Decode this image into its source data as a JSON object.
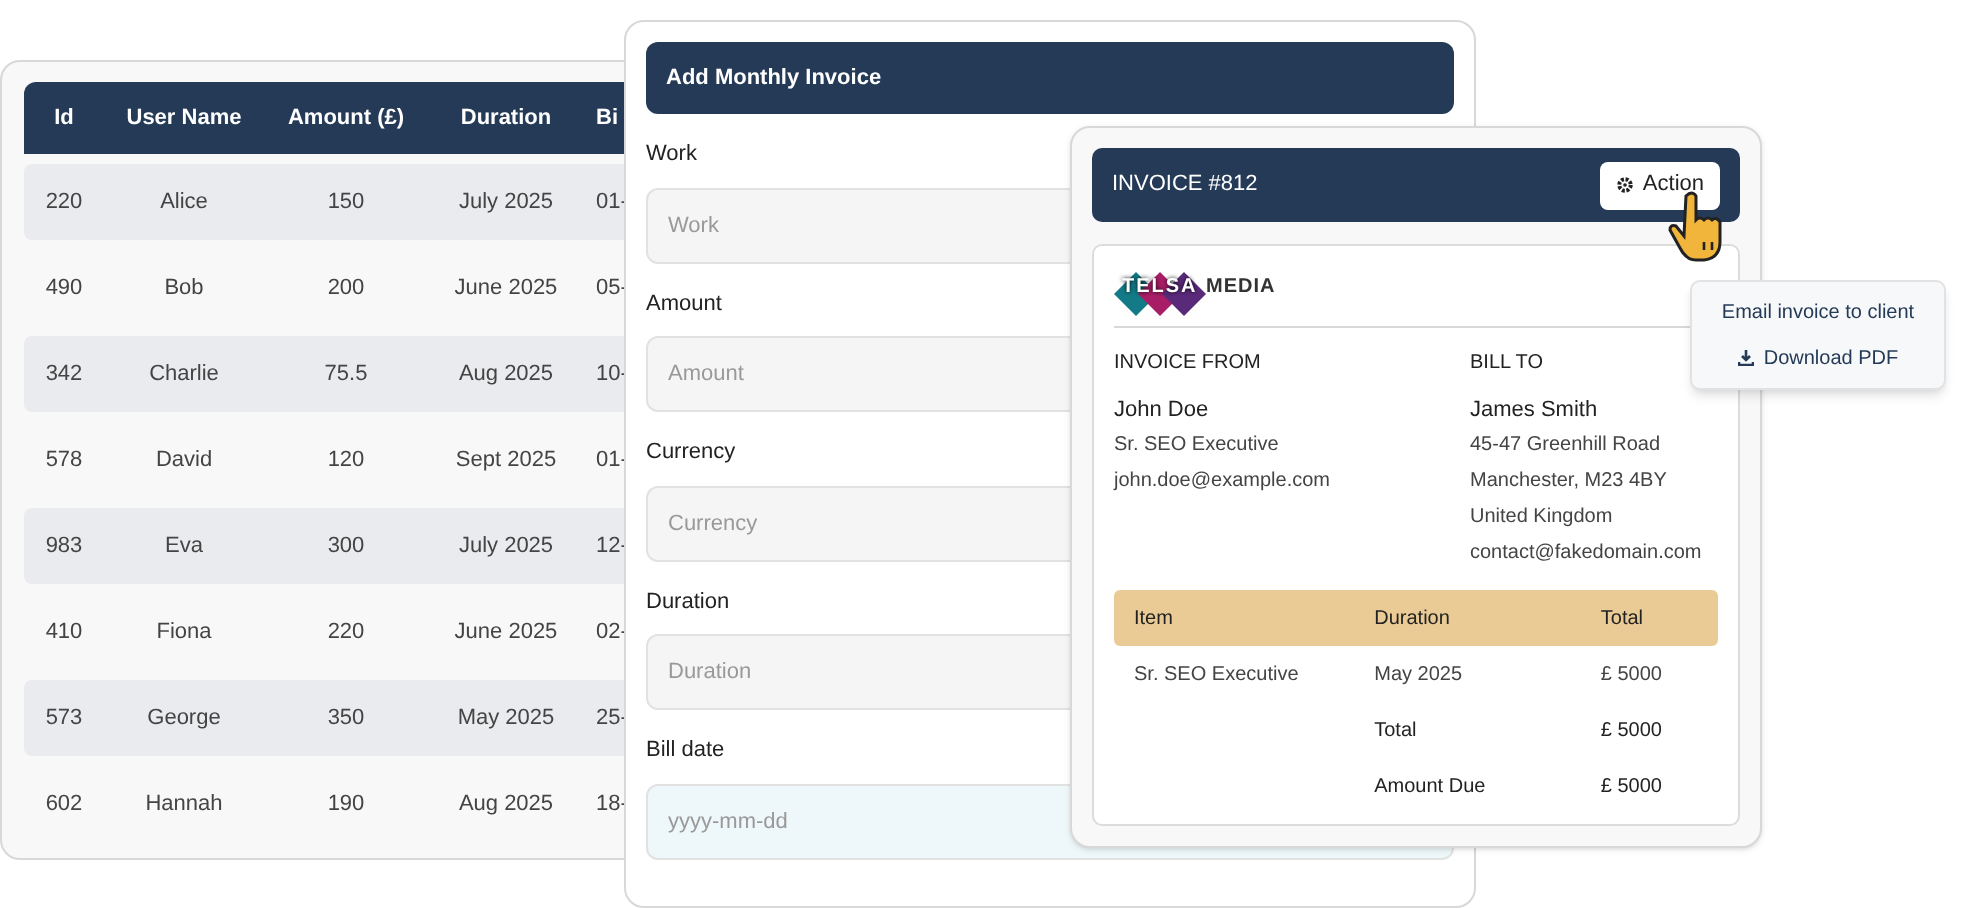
{
  "table": {
    "columns": [
      "Id",
      "User Name",
      "Amount (£)",
      "Duration",
      "Bi"
    ],
    "rows": [
      [
        "220",
        "Alice",
        "150",
        "July 2025",
        "01-"
      ],
      [
        "490",
        "Bob",
        "200",
        "June 2025",
        "05-"
      ],
      [
        "342",
        "Charlie",
        "75.5",
        "Aug 2025",
        "10-"
      ],
      [
        "578",
        "David",
        "120",
        "Sept 2025",
        "01-"
      ],
      [
        "983",
        "Eva",
        "300",
        "July 2025",
        "12-"
      ],
      [
        "410",
        "Fiona",
        "220",
        "June 2025",
        "02-"
      ],
      [
        "573",
        "George",
        "350",
        "May 2025",
        "25-"
      ],
      [
        "602",
        "Hannah",
        "190",
        "Aug 2025",
        "18-"
      ]
    ]
  },
  "form": {
    "title": "Add Monthly Invoice",
    "fields": [
      {
        "label": "Work",
        "placeholder": "Work",
        "kind": "text"
      },
      {
        "label": "Amount",
        "placeholder": "Amount",
        "kind": "text"
      },
      {
        "label": "Currency",
        "placeholder": "Currency",
        "kind": "text"
      },
      {
        "label": "Duration",
        "placeholder": "Duration",
        "kind": "text"
      },
      {
        "label": "Bill date",
        "placeholder": "yyyy-mm-dd",
        "kind": "date"
      }
    ]
  },
  "invoice": {
    "title": "INVOICE #812",
    "action_button": "Action",
    "logo": {
      "left": "TELSA",
      "right": "MEDIA"
    },
    "from": {
      "heading": "INVOICE FROM",
      "lines": [
        "John Doe",
        "Sr. SEO Executive",
        "john.doe@example.com"
      ]
    },
    "bill_to": {
      "heading": "BILL TO",
      "lines": [
        "James Smith",
        "45-47 Greenhill Road",
        "Manchester, M23 4BY",
        "United Kingdom",
        "contact@fakedomain.com"
      ]
    },
    "items": {
      "columns": [
        "Item",
        "Duration",
        "Total"
      ],
      "rows": [
        [
          "Sr. SEO Executive",
          "May 2025",
          "£ 5000"
        ]
      ],
      "summary": [
        {
          "label": "Total",
          "value": "£ 5000"
        },
        {
          "label": "Amount Due",
          "value": "£ 5000"
        }
      ]
    }
  },
  "action_menu": [
    {
      "label": "Email invoice to client",
      "kind": "plain"
    },
    {
      "label": "Download PDF",
      "kind": "download"
    }
  ]
}
